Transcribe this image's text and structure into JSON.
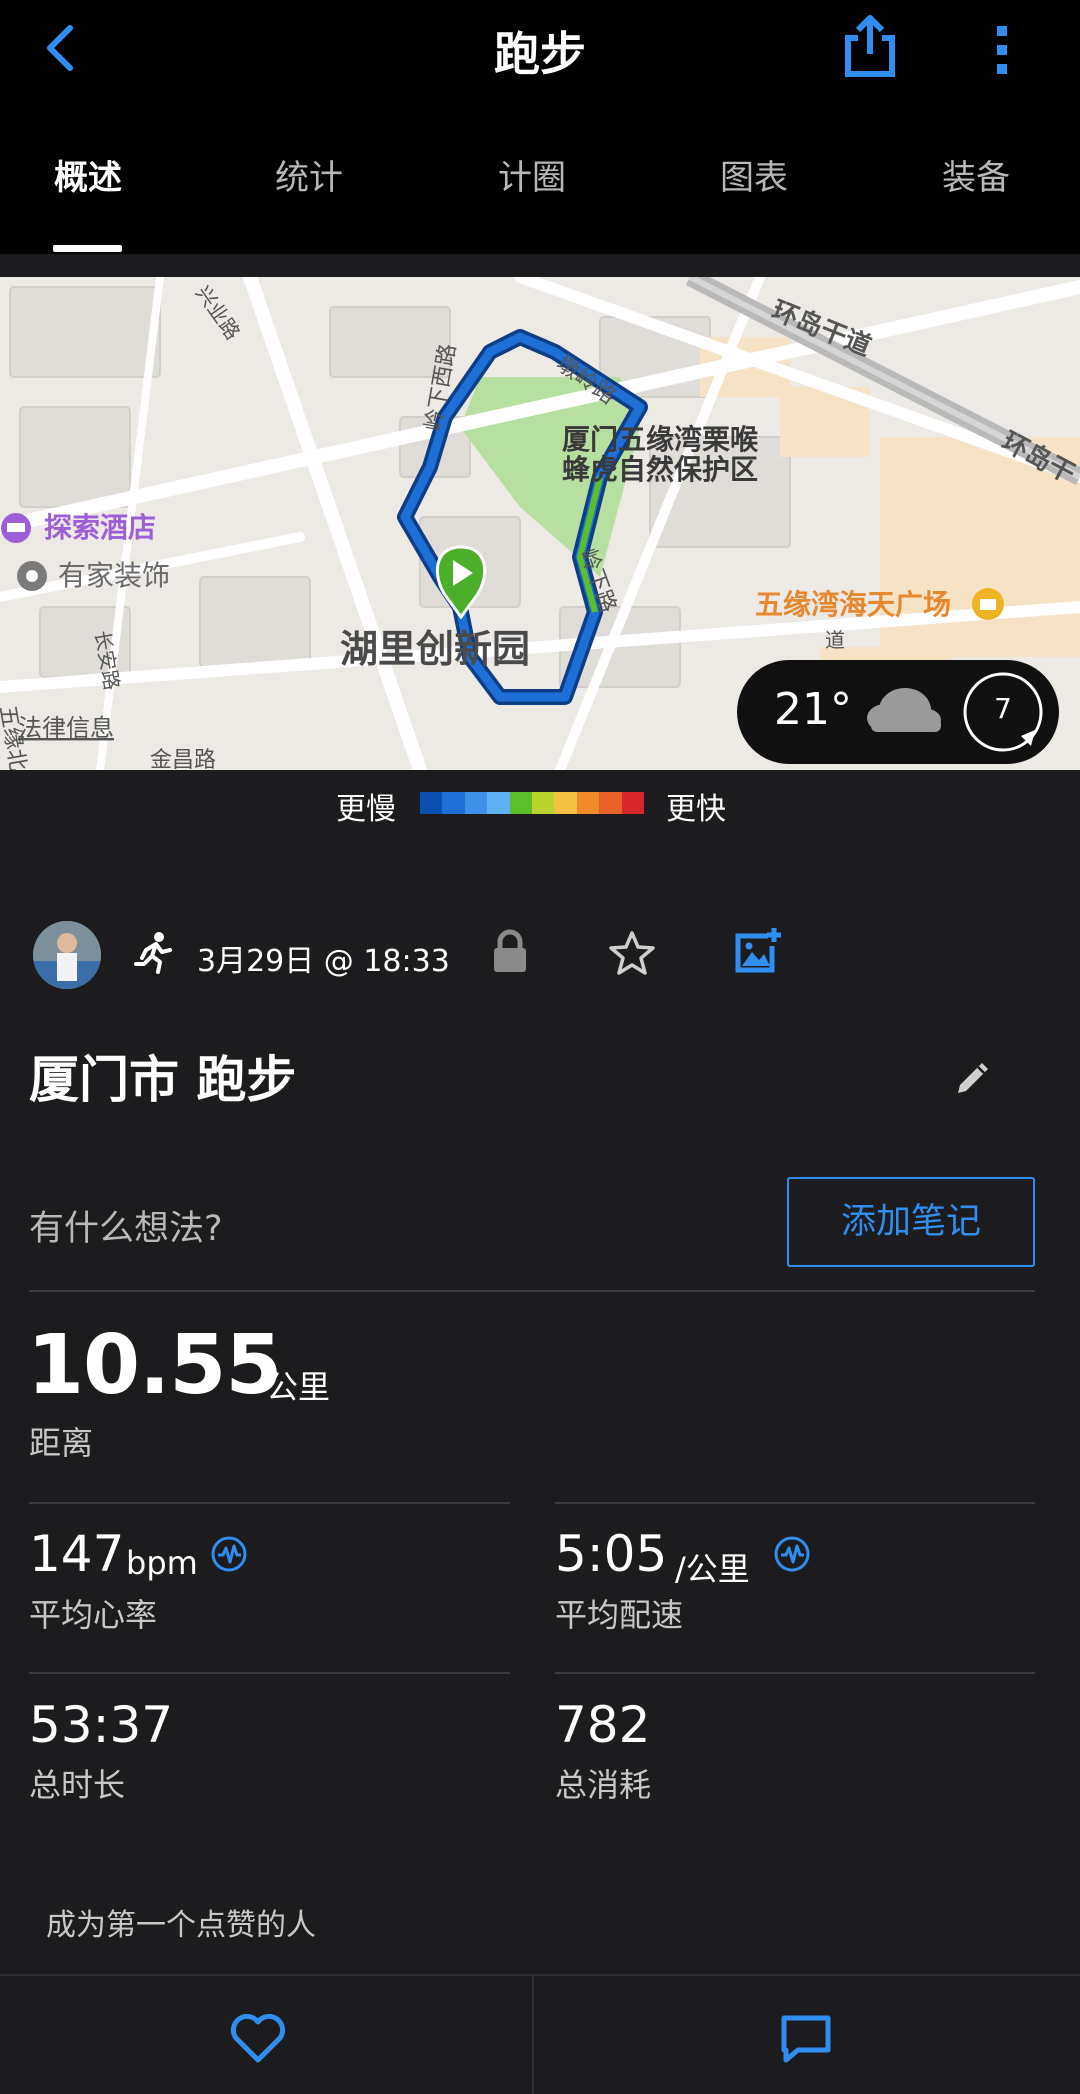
{
  "header": {
    "title": "跑步",
    "tabs": [
      {
        "label": "概述",
        "active": true
      },
      {
        "label": "统计"
      },
      {
        "label": "计圈"
      },
      {
        "label": "图表"
      },
      {
        "label": "装备"
      }
    ]
  },
  "map": {
    "labels": {
      "poi_park": "厦门五缘湾栗喉",
      "poi_park2": "蜂虎自然保护区",
      "hotel": "探索酒店",
      "decor": "有家装饰",
      "start_place": "湖里创新园",
      "mall": "五缘湾海天广场",
      "road_ring": "环岛干道",
      "road_ring2": "环岛干",
      "road_1": "墩岭路",
      "road_2": "岭下西路",
      "road_3": "岭下路",
      "road_4": "长安路",
      "road_5": "金昌路",
      "road_6": "五缘北路",
      "road_7": "兴业路",
      "road_8": "道",
      "legal": "法律信息"
    },
    "weather": {
      "temperature": "21°",
      "icon": "cloud-icon",
      "wind_speed": "7"
    }
  },
  "legend": {
    "slow_label": "更慢",
    "fast_label": "更快",
    "colors": [
      "#0a4fb0",
      "#1e6fd6",
      "#3f8fe8",
      "#5fb1f2",
      "#5cbf2a",
      "#b9d32f",
      "#f4c143",
      "#f08a2a",
      "#e8622a",
      "#d9262b"
    ]
  },
  "activity": {
    "type_icon": "running-icon",
    "datetime": "3月29日 @ 18:33",
    "title": "厦门市 跑步",
    "thoughts_placeholder": "有什么想法?",
    "add_note_label": "添加笔记"
  },
  "stats": {
    "distance": {
      "value": "10.55",
      "unit": "公里",
      "label": "距离"
    },
    "heart_rate": {
      "value": "147",
      "unit": "bpm",
      "label": "平均心率"
    },
    "pace": {
      "value": "5:05",
      "unit": "/公里",
      "label": "平均配速"
    },
    "duration": {
      "value": "53:37",
      "label": "总时长"
    },
    "calories": {
      "value": "782",
      "label": "总消耗"
    }
  },
  "social": {
    "like_prompt": "成为第一个点赞的人"
  },
  "colors": {
    "accent": "#2f8ef0",
    "background": "#1c1c1e",
    "header": "#000000",
    "route_blue": "#1e6fd6",
    "start_green": "#4caf2a"
  }
}
